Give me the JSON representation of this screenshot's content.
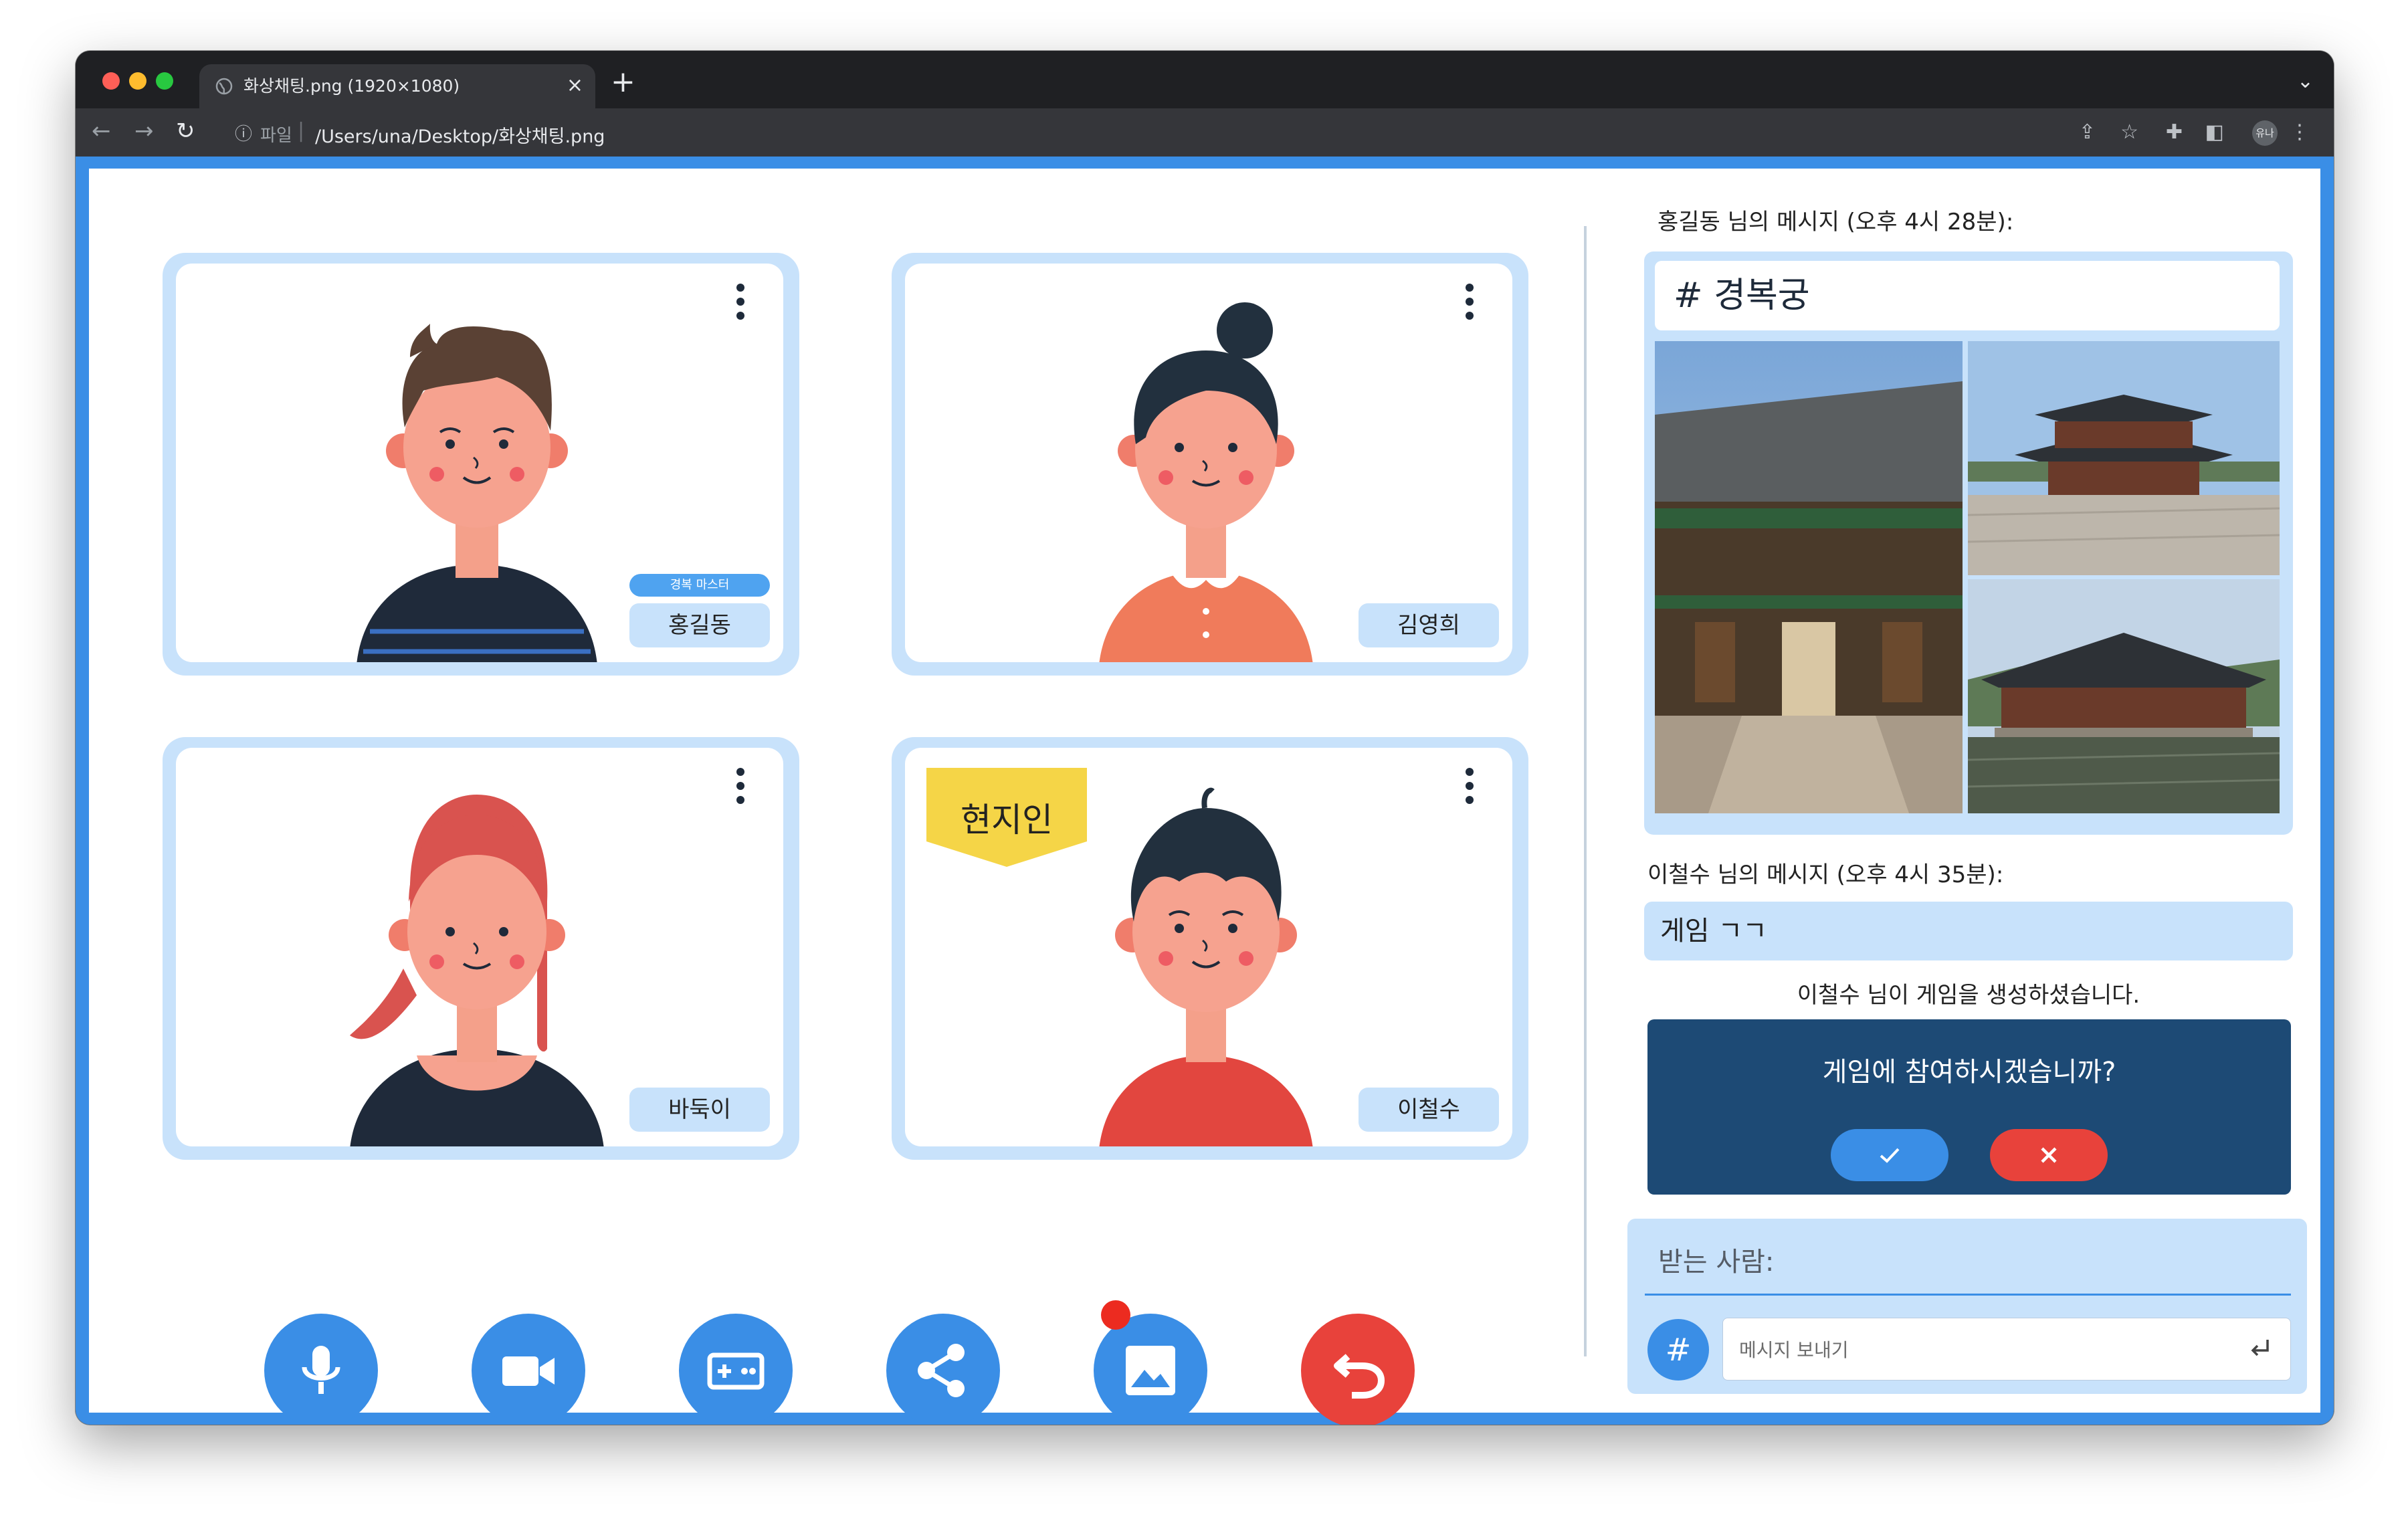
{
  "browser": {
    "tab_title": "화상채팅.png (1920×1080)",
    "tab_close": "×",
    "new_tab": "+",
    "url_scheme_label": "파일",
    "url": "/Users/una/Desktop/화상채팅.png",
    "profile_initials": "유나"
  },
  "participants": [
    {
      "name": "홍길동",
      "title_badge": "경복 마스터",
      "avatar": "man-brown-hair",
      "shirt_color": "#1f2a3a"
    },
    {
      "name": "김영희",
      "avatar": "woman-bun",
      "shirt_color": "#f07b5b"
    },
    {
      "name": "바둑이",
      "avatar": "woman-red-hair",
      "shirt_color": "#1f2a3a"
    },
    {
      "name": "이철수",
      "avatar": "boy-black-hair",
      "shirt_color": "#e2463f",
      "tag": "현지인"
    }
  ],
  "controls": [
    {
      "id": "mic",
      "icon": "microphone-icon",
      "color": "#3a8ee6"
    },
    {
      "id": "camera",
      "icon": "video-camera-icon",
      "color": "#3a8ee6"
    },
    {
      "id": "game",
      "icon": "gamepad-icon",
      "color": "#3a8ee6"
    },
    {
      "id": "share",
      "icon": "share-icon",
      "color": "#3a8ee6"
    },
    {
      "id": "image",
      "icon": "image-icon",
      "color": "#3a8ee6",
      "has_notification": true
    },
    {
      "id": "leave",
      "icon": "undo-icon",
      "color": "#e8423b"
    }
  ],
  "chat": {
    "message1_header": "홍길동 님의 메시지 (오후 4시 28분):",
    "message1_hashtag": "# 경복궁",
    "message2_header": "이철수 님의 메시지 (오후 4시 35분):",
    "message2_text": "게임 ㄱㄱ",
    "system_message": "이철수 님이 게임을 생성하셨습니다.",
    "game_prompt": "게임에 참여하시겠습니까?",
    "accept_icon": "check-icon",
    "decline_icon": "x-icon",
    "recipient_label": "받는 사람:",
    "hash_button": "#",
    "input_placeholder": "메시지 보내기"
  },
  "colors": {
    "accent": "#3a8ee6",
    "tile_border": "#c8e2fb",
    "game_card": "#1d4a75",
    "decline": "#e8423b"
  }
}
